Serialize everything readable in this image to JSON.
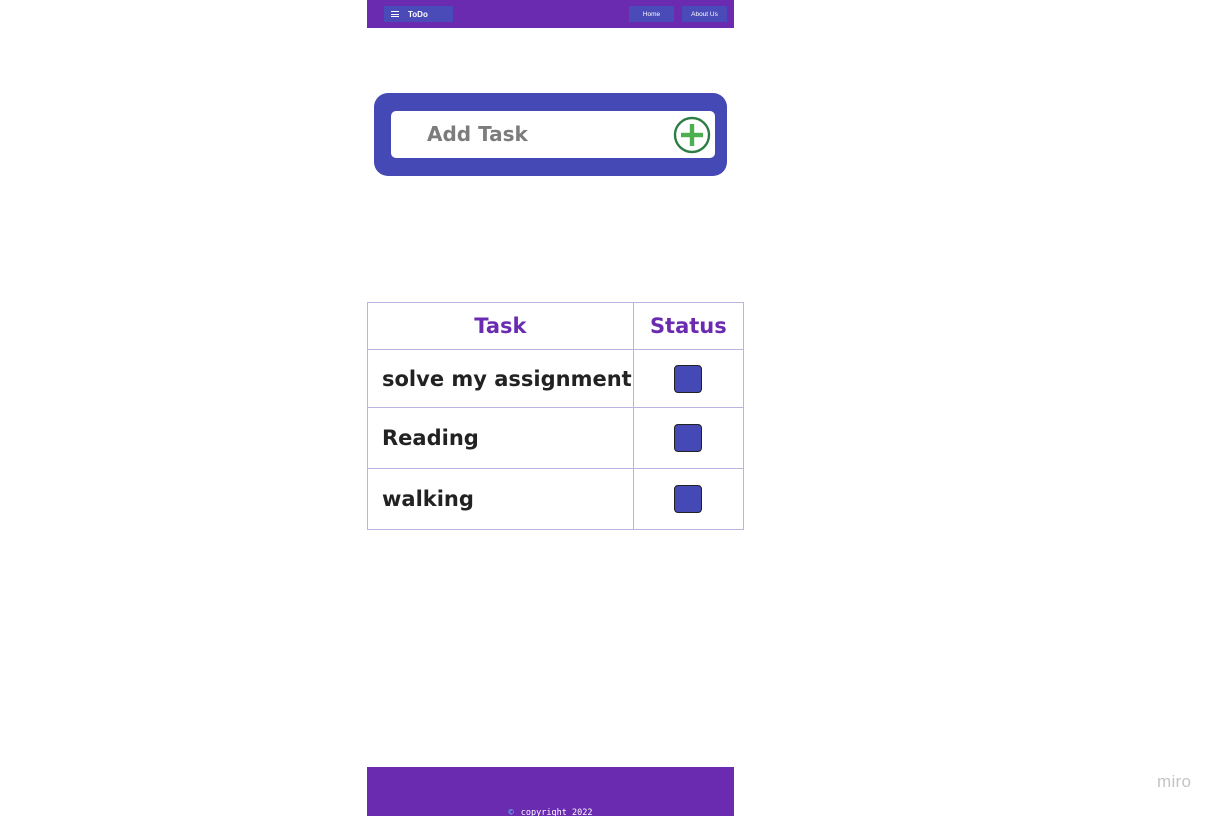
{
  "navbar": {
    "brand": "ToDo",
    "menu_icon": "hamburger-icon",
    "links": [
      {
        "label": "Home"
      },
      {
        "label": "About Us"
      }
    ]
  },
  "add_task": {
    "placeholder": "Add Task",
    "value": "",
    "button_icon": "plus-circle-icon"
  },
  "table": {
    "headers": [
      "Task",
      "Status"
    ],
    "rows": [
      {
        "task": "solve my assignment",
        "done": false
      },
      {
        "task": "Reading",
        "done": false
      },
      {
        "task": "walking",
        "done": false
      }
    ]
  },
  "footer": {
    "copyright_symbol": "©",
    "copyright_text": "copyright 2022"
  },
  "watermark": "miro",
  "colors": {
    "primary": "#6a2bb0",
    "accent": "#4549b5",
    "add_icon": "#2e8b4a"
  }
}
